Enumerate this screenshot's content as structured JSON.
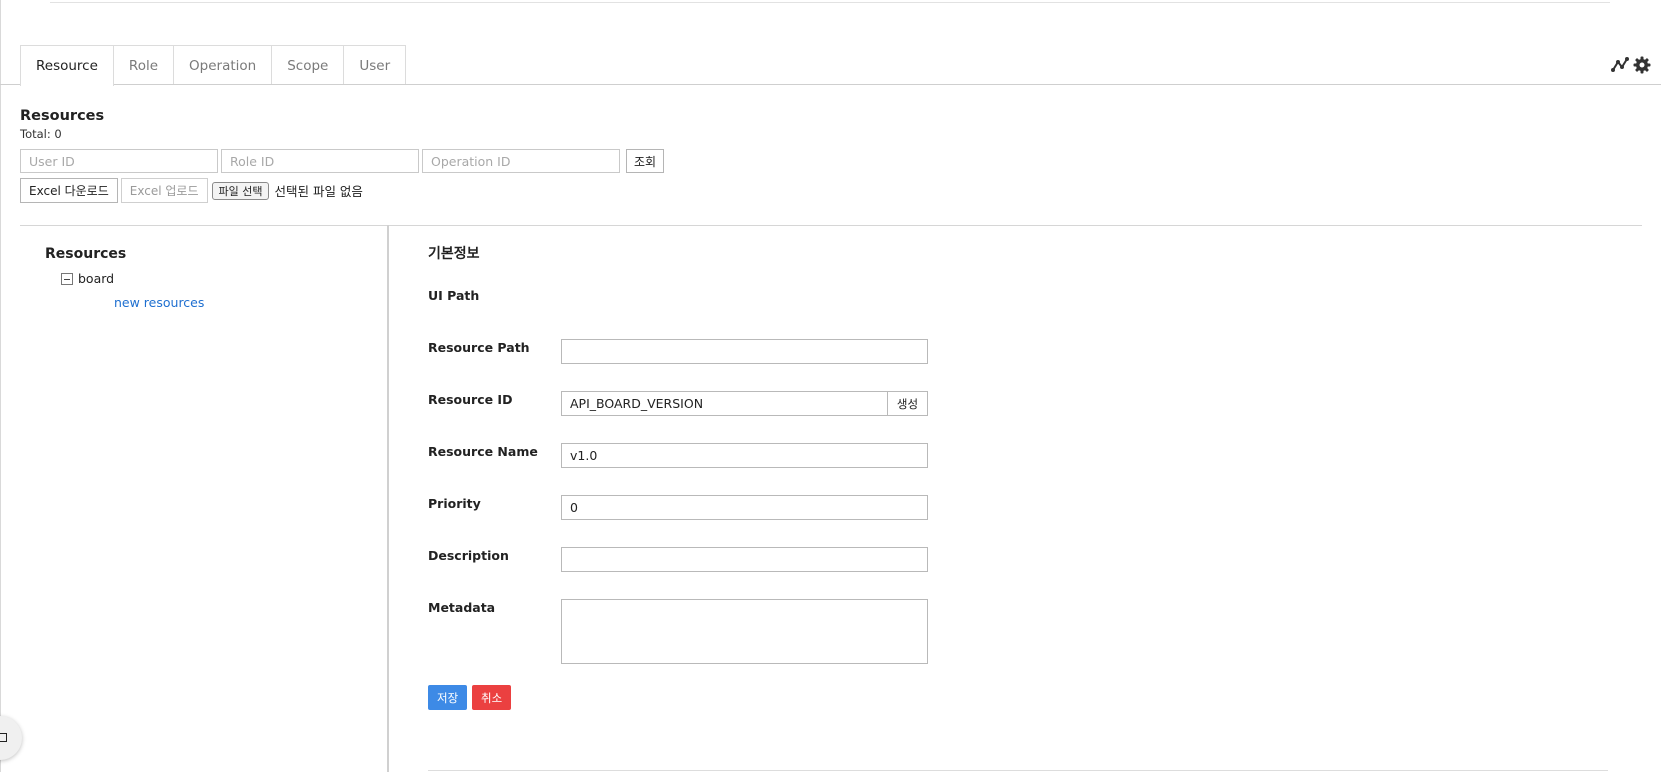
{
  "tabs": [
    {
      "label": "Resource",
      "active": true
    },
    {
      "label": "Role",
      "active": false
    },
    {
      "label": "Operation",
      "active": false
    },
    {
      "label": "Scope",
      "active": false
    },
    {
      "label": "User",
      "active": false
    }
  ],
  "top_icons": [
    "graph-icon",
    "gear-icon"
  ],
  "section": {
    "title": "Resources",
    "total": "Total: 0"
  },
  "filters": {
    "user_id_placeholder": "User ID",
    "role_id_placeholder": "Role ID",
    "operation_id_placeholder": "Operation ID",
    "query_label": "조회"
  },
  "excel": {
    "download_label": "Excel 다운로드",
    "upload_label": "Excel 업로드",
    "file_button_label": "파일 선택",
    "file_status": "선택된 파일 없음"
  },
  "tree": {
    "title": "Resources",
    "node_label": "board",
    "link_label": "new resources"
  },
  "form": {
    "title": "기본정보",
    "ui_path_label": "UI Path",
    "resource_path_label": "Resource Path",
    "resource_path_value": "",
    "resource_id_label": "Resource ID",
    "resource_id_value": "API_BOARD_VERSION",
    "generate_label": "생성",
    "resource_name_label": "Resource Name",
    "resource_name_value": "v1.0",
    "priority_label": "Priority",
    "priority_value": "0",
    "description_label": "Description",
    "description_value": "",
    "metadata_label": "Metadata",
    "metadata_value": "",
    "save_label": "저장",
    "cancel_label": "취소"
  },
  "colors": {
    "save": "#3d8ae6",
    "cancel": "#eb4040",
    "link": "#1e6fd0"
  }
}
